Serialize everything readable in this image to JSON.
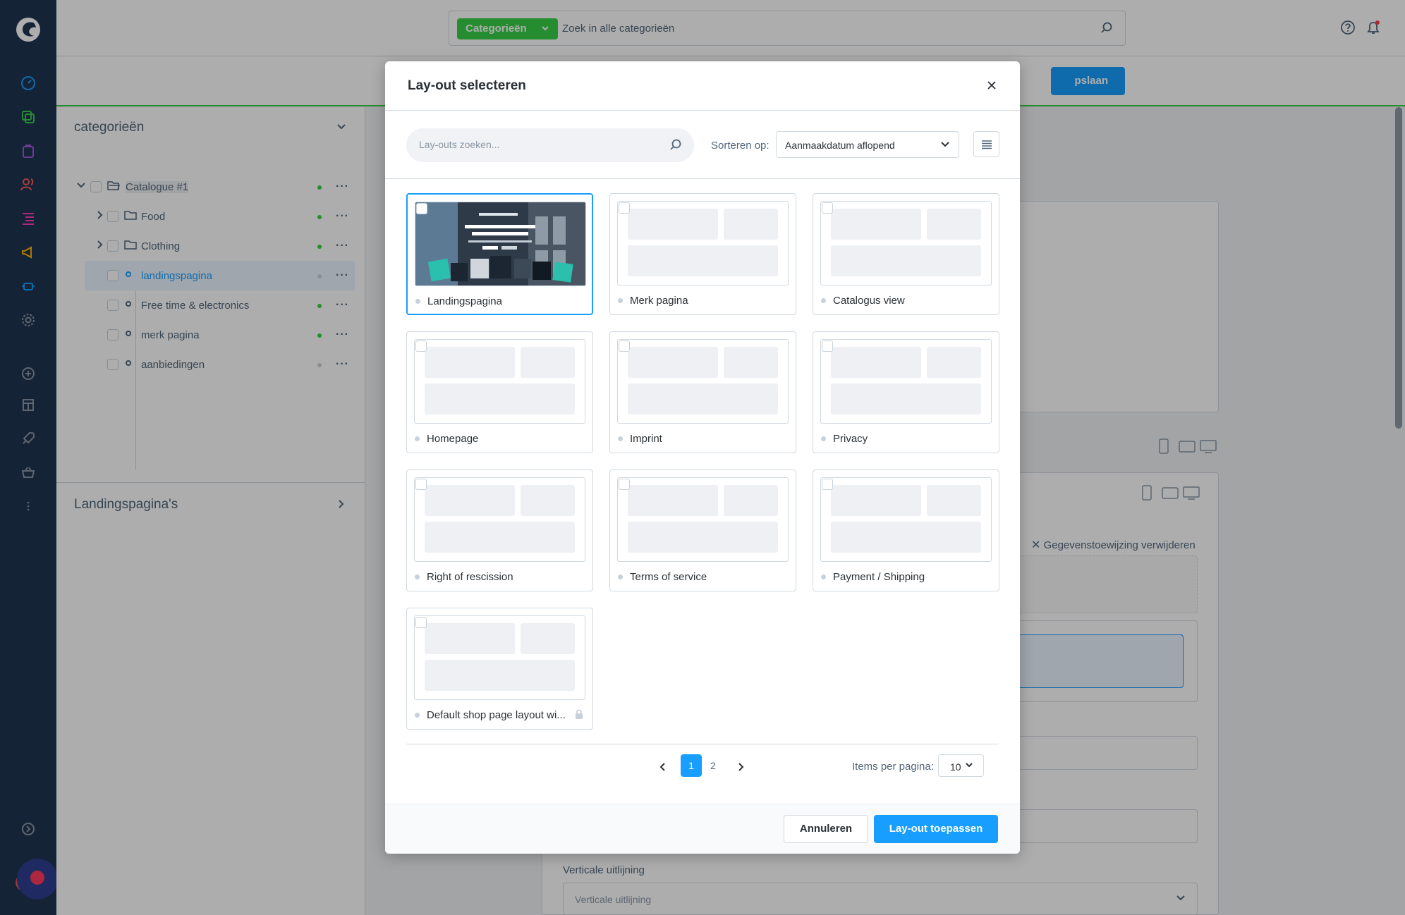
{
  "topbar": {
    "category_button": "Categorieën",
    "search_placeholder": "Zoek in alle categorieën"
  },
  "secondbar": {
    "save_label_partial": "pslaan"
  },
  "tree": {
    "header": "categorieën",
    "items": [
      {
        "label": "Catalogue #1"
      },
      {
        "label": "Food"
      },
      {
        "label": "Clothing"
      },
      {
        "label": "landingspagina"
      },
      {
        "label": "Free time & electronics"
      },
      {
        "label": "merk pagina"
      },
      {
        "label": "aanbiedingen"
      }
    ],
    "landing_section": "Landingspagina's"
  },
  "background": {
    "remove_assignment": "Gegevenstoewijzing verwijderen",
    "vertical_align_label": "Verticale uitlijning",
    "vertical_align_placeholder": "Verticale uitlijning"
  },
  "modal": {
    "title": "Lay-out selecteren",
    "search_placeholder": "Lay-outs zoeken...",
    "sort_label": "Sorteren op:",
    "sort_value": "Aanmaakdatum aflopend",
    "layouts": [
      {
        "name": "Landingspagina"
      },
      {
        "name": "Merk pagina"
      },
      {
        "name": "Catalogus view"
      },
      {
        "name": "Homepage"
      },
      {
        "name": "Imprint"
      },
      {
        "name": "Privacy"
      },
      {
        "name": "Right of rescission"
      },
      {
        "name": "Terms of service"
      },
      {
        "name": "Payment / Shipping"
      },
      {
        "name": "Default shop page layout wi..."
      }
    ],
    "pagination": {
      "pages": [
        "1",
        "2"
      ],
      "current": "1",
      "items_per_page_label": "Items per pagina:",
      "items_per_page": "10"
    },
    "cancel_label": "Annuleren",
    "apply_label": "Lay-out toepassen"
  },
  "colors": {
    "nav_bg": "#1f3450",
    "accent": "#189eff",
    "green": "#37d046"
  }
}
